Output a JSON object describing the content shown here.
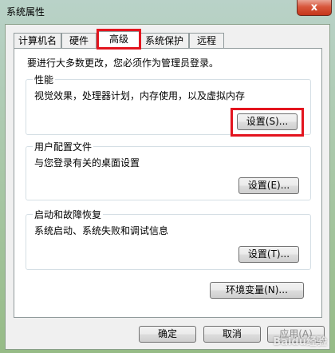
{
  "window": {
    "title": "系统属性",
    "close_label": "x"
  },
  "tabs": [
    {
      "label": "计算机名"
    },
    {
      "label": "硬件"
    },
    {
      "label": "高级"
    },
    {
      "label": "系统保护"
    },
    {
      "label": "远程"
    }
  ],
  "active_tab": "高级",
  "panel": {
    "admin_note": "要进行大多数更改，您必须作为管理员登录。",
    "performance": {
      "title": "性能",
      "desc": "视觉效果，处理器计划，内存使用，以及虚拟内存",
      "button": "设置(S)..."
    },
    "user_profiles": {
      "title": "用户配置文件",
      "desc": "与您登录有关的桌面设置",
      "button": "设置(E)..."
    },
    "startup_recovery": {
      "title": "启动和故障恢复",
      "desc": "系统启动、系统失败和调试信息",
      "button": "设置(T)..."
    },
    "env_button": "环境变量(N)..."
  },
  "footer": {
    "ok": "确定",
    "cancel": "取消",
    "apply": "应用(A)"
  },
  "watermark": "Baidu经验",
  "colors": {
    "highlight": "#e3141e",
    "close": "#c5361a"
  }
}
